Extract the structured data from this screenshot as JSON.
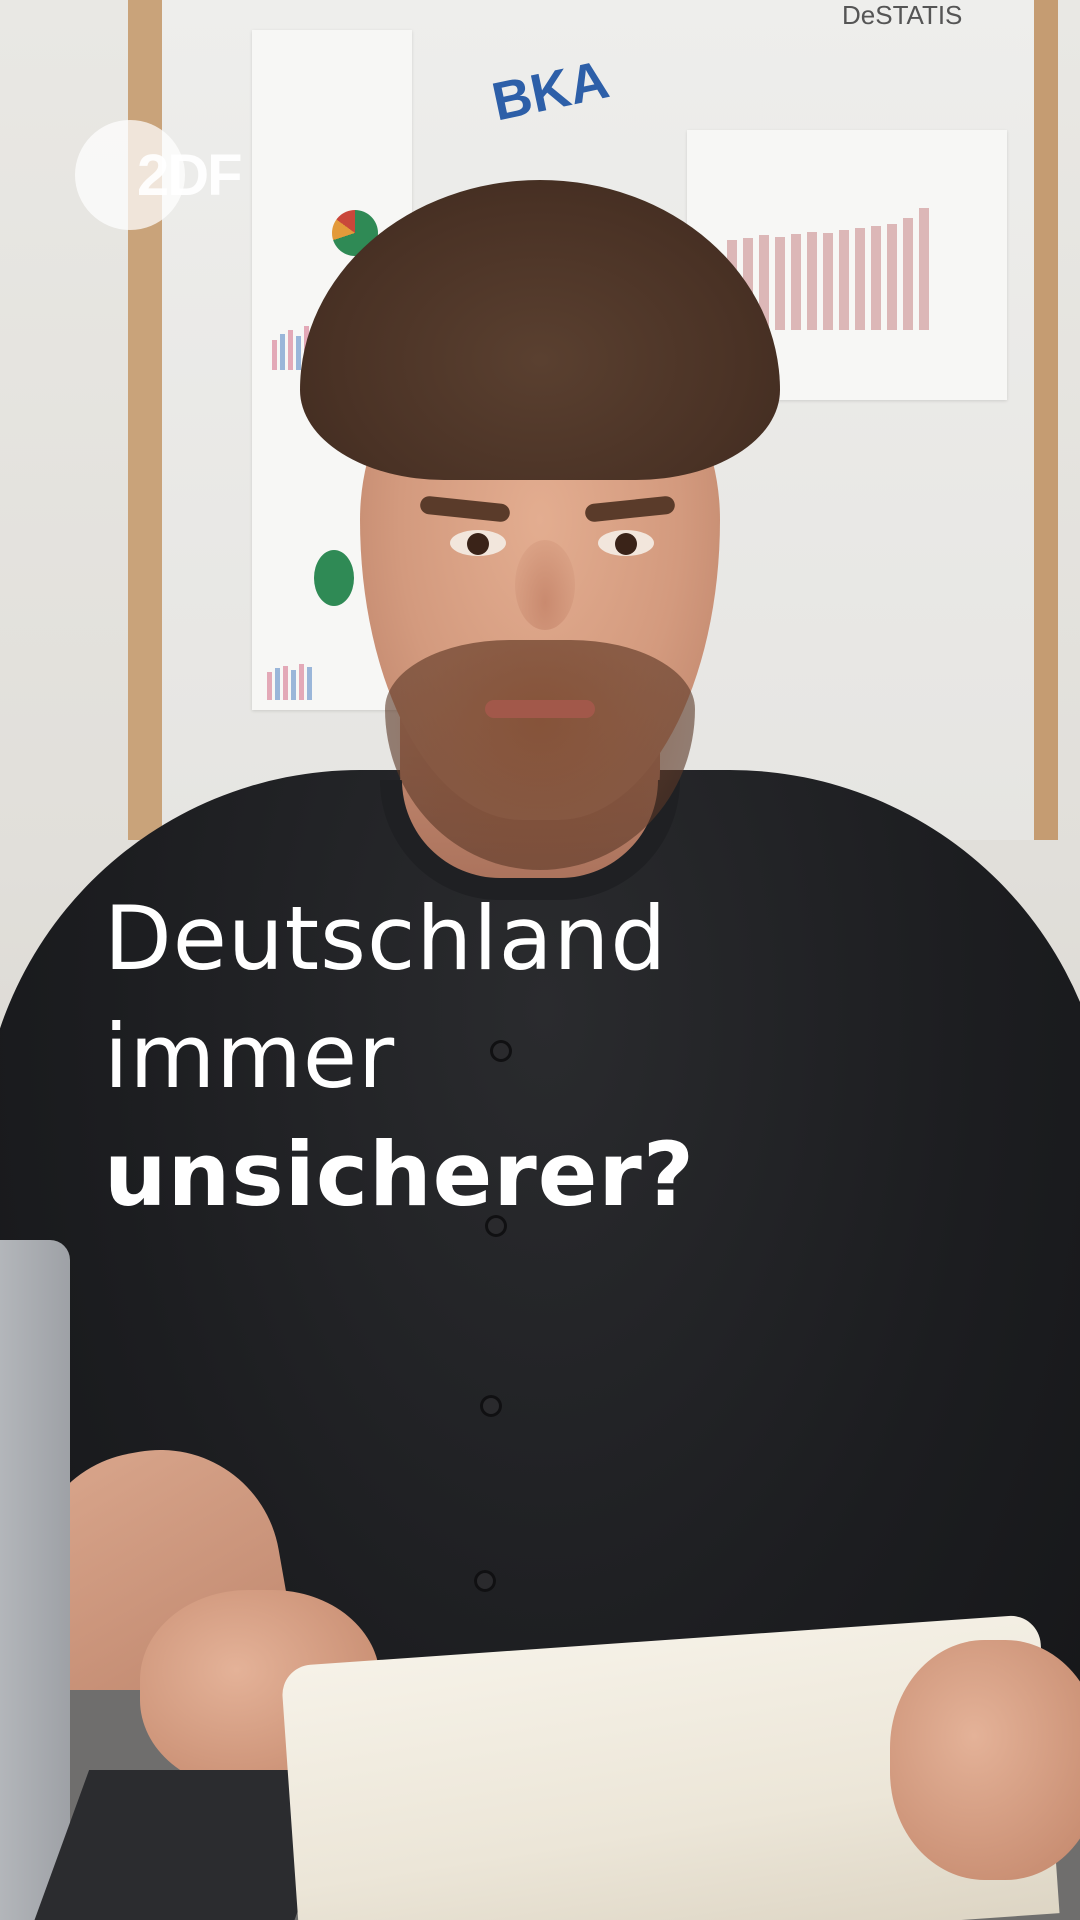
{
  "logo": {
    "text": "2DF"
  },
  "headline": {
    "line1": "Deutschland",
    "line2": "immer",
    "line3": "unsicherer?"
  },
  "background": {
    "poster_logo_text": "BKA",
    "poster_brand_text": "DeSTATIS"
  },
  "colors": {
    "headline": "#ffffff",
    "shirt": "#1c1d20",
    "board_frame": "#c9a37a"
  }
}
